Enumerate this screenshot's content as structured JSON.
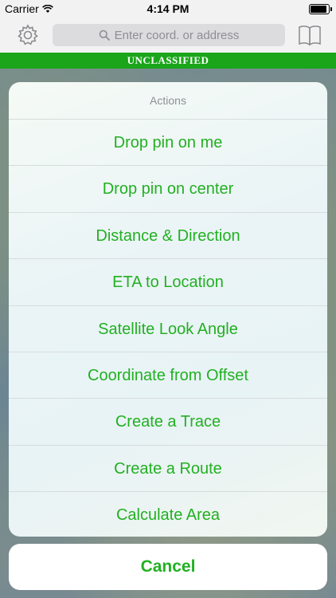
{
  "status_bar": {
    "carrier": "Carrier",
    "time": "4:14 PM"
  },
  "nav": {
    "search_placeholder": "Enter coord. or address"
  },
  "banner": {
    "text": "UNCLASSIFIED"
  },
  "action_sheet": {
    "title": "Actions",
    "items": [
      {
        "label": "Drop pin on me"
      },
      {
        "label": "Drop pin on center"
      },
      {
        "label": "Distance & Direction"
      },
      {
        "label": "ETA to Location"
      },
      {
        "label": "Satellite Look Angle"
      },
      {
        "label": "Coordinate from Offset"
      },
      {
        "label": "Create a Trace"
      },
      {
        "label": "Create a Route"
      },
      {
        "label": "Calculate Area"
      }
    ],
    "cancel_label": "Cancel"
  },
  "colors": {
    "accent": "#22b022",
    "banner": "#1aa51a"
  }
}
